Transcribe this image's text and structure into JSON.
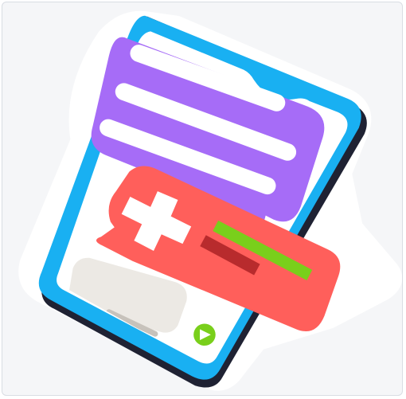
{
  "illustration": {
    "colors": {
      "card_background": "#f5f6f8",
      "card_border": "#d9dde3",
      "sticker_outline": "#ffffff",
      "phone_frame": "#19b0f2",
      "phone_shadow": "#1f2233",
      "phone_screen": "#ffffff",
      "top_bubble": "#a66cf7",
      "top_bubble_lines": "#ffffff",
      "bottom_bubble": "#ff5f5b",
      "plus_sign": "#ffffff",
      "green_bar": "#79cf1b",
      "dark_red_bar": "#b82b2d",
      "input_pill": "#ece9e4",
      "home_indicator": "#c7c2bb",
      "send_button": "#79cf1b",
      "send_arrow": "#ffffff"
    },
    "icons": {
      "phone": "smartphone-icon",
      "top_bubble": "chat-bubble-icon",
      "bottom_bubble": "medical-alert-bubble-icon",
      "plus": "plus-icon",
      "send": "send-arrow-icon"
    }
  }
}
